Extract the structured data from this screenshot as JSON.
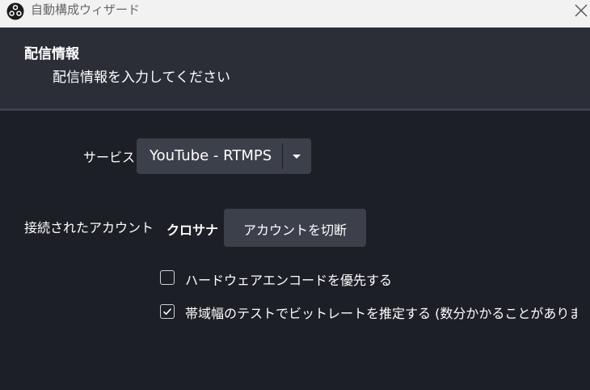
{
  "window": {
    "title": "自動構成ウィザード",
    "app_icon": "obs-logo-icon",
    "close_icon": "close-icon"
  },
  "header": {
    "title": "配信情報",
    "subtitle": "配信情報を入力してください"
  },
  "form": {
    "service_label": "サービス",
    "service_value": "YouTube - RTMPS",
    "account_label": "接続されたアカウント",
    "account_name": "クロサナ",
    "disconnect_button": "アカウントを切断",
    "options": [
      {
        "label": "ハードウェアエンコードを優先する",
        "checked": false
      },
      {
        "label": "帯域幅のテストでビットレートを推定する (数分かかることがあります)",
        "checked": true
      }
    ]
  },
  "colors": {
    "background": "#1d1f26",
    "header_bg": "#2b2e37",
    "control_bg": "#3c404b",
    "titlebar_bg": "#f2f2f2"
  }
}
